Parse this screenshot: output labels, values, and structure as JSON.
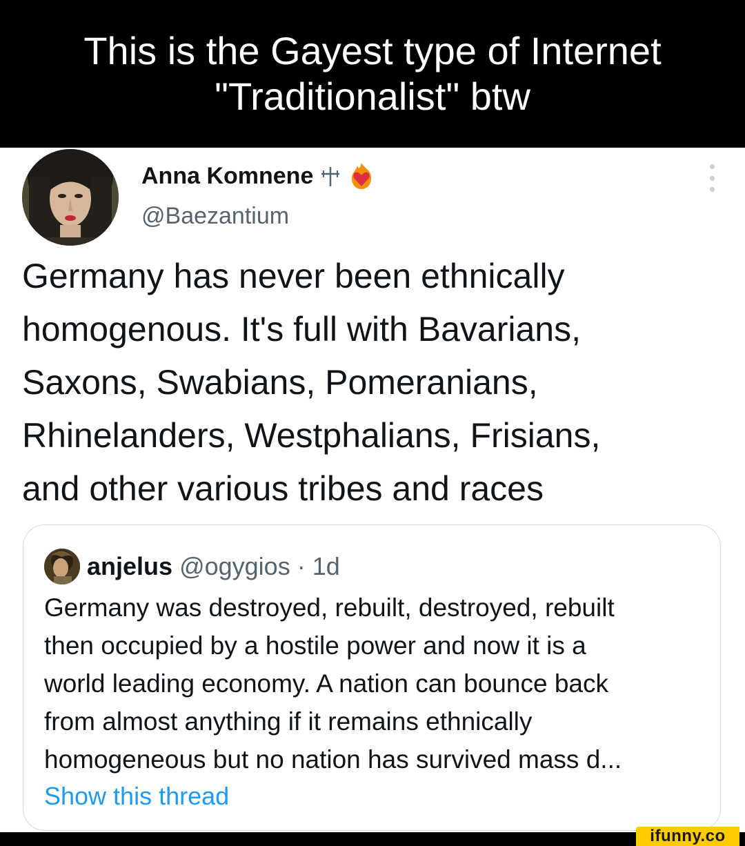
{
  "caption": {
    "line1": "This is the Gayest type of Internet",
    "line2": "\"Traditionalist\" btw"
  },
  "tweet": {
    "display_name": "Anna Komnene",
    "name_symbols": [
      "cross-icon",
      "fire-heart-emoji"
    ],
    "handle": "@Baezantium",
    "text_lines": [
      "Germany has never been ethnically",
      "homogenous. It's full with Bavarians,",
      "Saxons, Swabians, Pomeranians,",
      "Rhinelanders, Westphalians, Frisians,",
      "and other various tribes and races"
    ]
  },
  "quote": {
    "name": "anjelus",
    "handle": "@ogygios",
    "separator": "·",
    "time": "1d",
    "text_lines": [
      "Germany was destroyed, rebuilt, destroyed, rebuilt",
      "then occupied by a hostile power and now it is a",
      "world leading economy. A nation can bounce back",
      "from almost anything if it remains ethnically",
      "homogeneous but no nation has survived mass d..."
    ],
    "show_thread": "Show this thread"
  },
  "watermark": {
    "text": "ifunny.co"
  },
  "colors": {
    "caption_bg": "#000000",
    "caption_text": "#ffffff",
    "primary_text": "#0f1419",
    "secondary_text": "#536471",
    "link": "#1d9bf0",
    "quote_border": "#cfd9de",
    "watermark_bg": "#ffcc00"
  }
}
